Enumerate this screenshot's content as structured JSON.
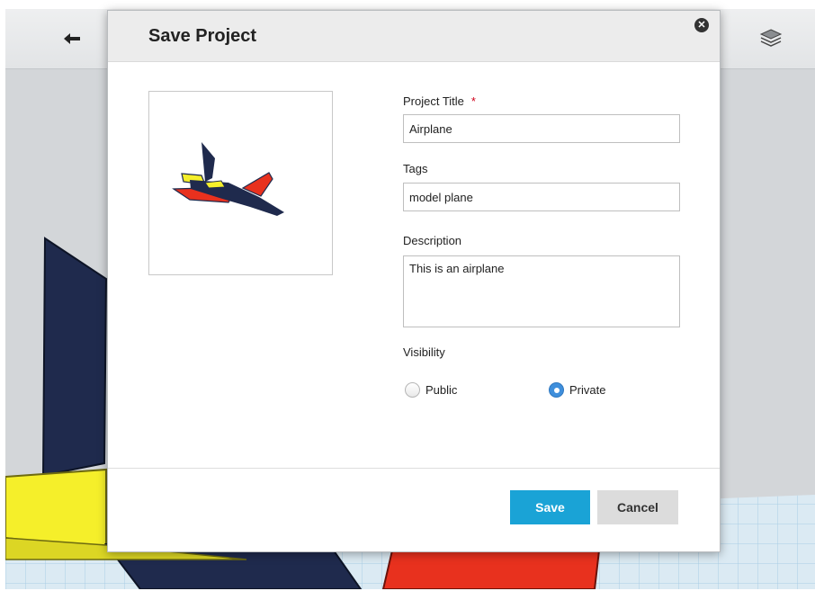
{
  "dialog": {
    "title": "Save Project",
    "close_icon": "close-icon",
    "thumbnail_icon": "airplane-model-thumbnail"
  },
  "form": {
    "title_label": "Project Title",
    "required_mark": "*",
    "title_value": "Airplane",
    "tags_label": "Tags",
    "tags_value": "model plane",
    "description_label": "Description",
    "description_value": "This is an airplane",
    "visibility_label": "Visibility",
    "visibility_options": [
      {
        "label": "Public",
        "selected": false
      },
      {
        "label": "Private",
        "selected": true
      }
    ]
  },
  "buttons": {
    "save": "Save",
    "cancel": "Cancel"
  },
  "toolbar": {
    "back_icon": "undo-arrow-icon",
    "layers_icon": "layers-icon"
  },
  "colors": {
    "primary_button": "#1aa3d6",
    "radio_selected": "#3f8fdc",
    "required": "#d0021b",
    "plane_navy": "#1f2a4d",
    "plane_yellow": "#f5ef2a",
    "plane_red": "#e8311e"
  }
}
